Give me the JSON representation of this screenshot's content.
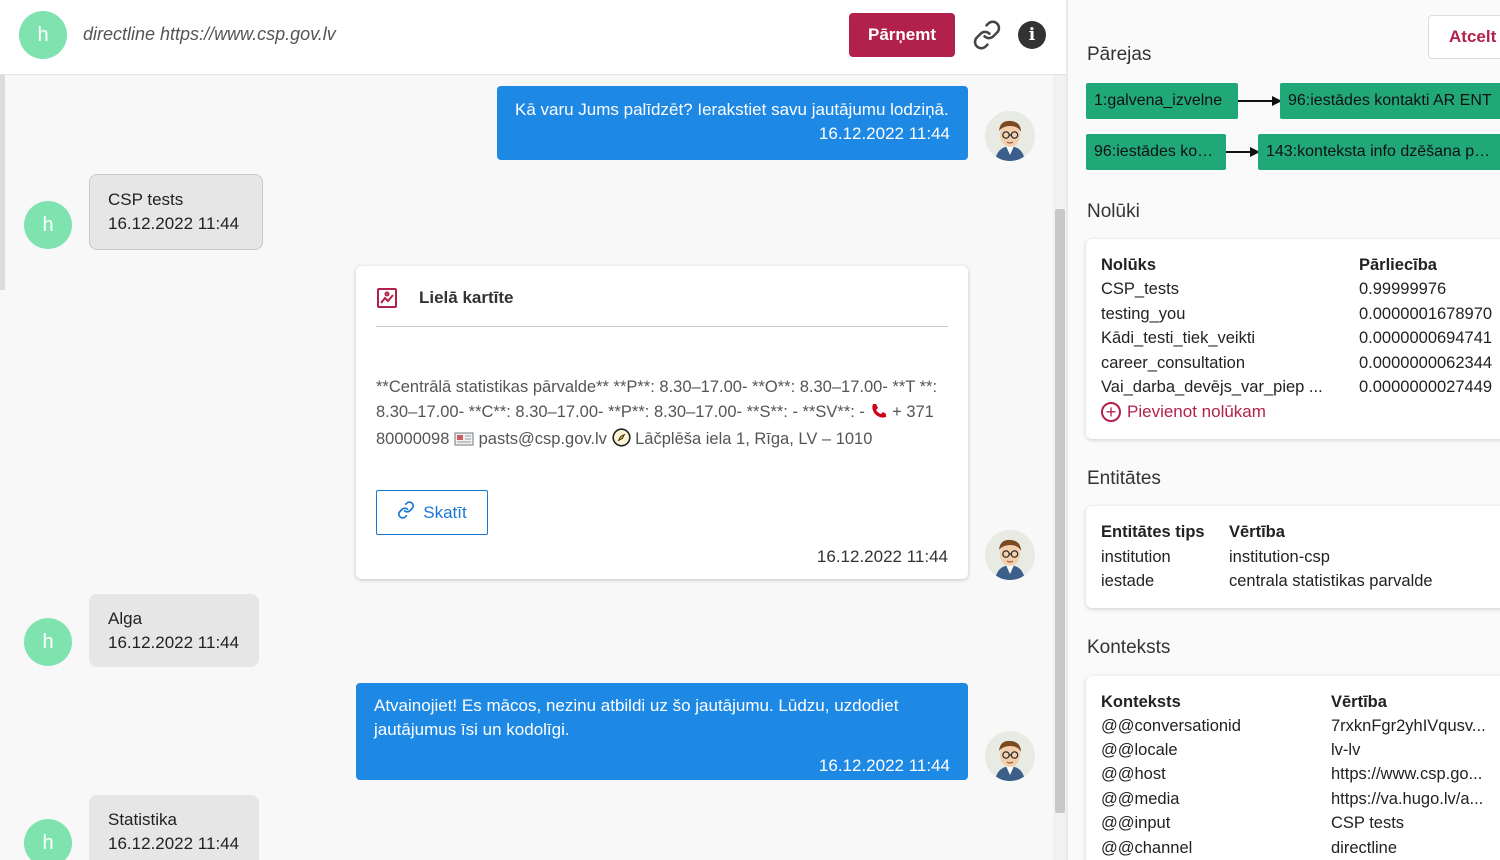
{
  "header": {
    "avatar_letter": "h",
    "title": "directline https://www.csp.gov.lv",
    "take_label": "Pārņemt"
  },
  "messages": [
    {
      "side": "bot",
      "text": "Kā varu Jums palīdzēt? Ierakstiet savu jautājumu lodziņā.",
      "time": "16.12.2022 11:44"
    },
    {
      "side": "user",
      "text": "CSP tests",
      "time": "16.12.2022 11:44"
    },
    {
      "side": "bot",
      "type": "card",
      "card_title": "Lielā kartīte",
      "card_text": "**Centrālā statistikas pārvalde** **P**: 8.30–17.00- **O**: 8.30–17.00- **T **: 8.30–17.00- **C**: 8.30–17.00- **P**: 8.30–17.00- **S**: - **SV**: - ",
      "phone": "+ 371 80000098",
      "email": "pasts@csp.gov.lv",
      "address": "Lāčplēša iela 1, Rīga, LV – 1010",
      "button_label": "Skatīt",
      "time": "16.12.2022 11:44"
    },
    {
      "side": "user",
      "text": "Alga",
      "time": "16.12.2022 11:44"
    },
    {
      "side": "bot",
      "text": "Atvainojiet! Es mācos, nezinu atbildi uz šo jautājumu. Lūdzu, uzdodiet jautājumus īsi un kodolīgi.",
      "time": "16.12.2022 11:44"
    },
    {
      "side": "user",
      "text": "Statistika",
      "time": "16.12.2022 11:44"
    }
  ],
  "right": {
    "cancel_label": "Atcelt",
    "transitions_title": "Pārejas",
    "transitions": [
      {
        "from": "1:galvena_izvelne",
        "to": "96:iestādes kontakti AR ENT"
      },
      {
        "from": "96:iestādes ko…",
        "to": "143:konteksta info dzēšana p…"
      }
    ],
    "intents_title": "Nolūki",
    "intents_header": {
      "name": "Nolūks",
      "confidence": "Pārliecība"
    },
    "intents": [
      {
        "name": "CSP_tests",
        "confidence": "0.99999976"
      },
      {
        "name": "testing_you",
        "confidence": "0.0000001678970"
      },
      {
        "name": "Kādi_testi_tiek_veikti",
        "confidence": "0.0000000694741"
      },
      {
        "name": "career_consultation",
        "confidence": "0.0000000062344"
      },
      {
        "name": "Vai_darba_devējs_var_piep ...",
        "confidence": "0.0000000027449"
      }
    ],
    "add_intent_label": "Pievienot nolūkam",
    "entities_title": "Entitātes",
    "entities_header": {
      "type": "Entitātes tips",
      "value": "Vērtība"
    },
    "entities": [
      {
        "type": "institution",
        "value": "institution-csp"
      },
      {
        "type": "iestade",
        "value": "centrala statistikas parvalde"
      }
    ],
    "context_title": "Konteksts",
    "context_header": {
      "key": "Konteksts",
      "value": "Vērtība"
    },
    "context": [
      {
        "key": "@@conversationid",
        "value": "7rxknFgr2yhIVqusv..."
      },
      {
        "key": "@@locale",
        "value": "lv-lv"
      },
      {
        "key": "@@host",
        "value": "https://www.csp.go..."
      },
      {
        "key": "@@media",
        "value": "https://va.hugo.lv/a..."
      },
      {
        "key": "@@input",
        "value": "CSP tests"
      },
      {
        "key": "@@channel",
        "value": "directline"
      }
    ]
  },
  "colors": {
    "accent": "#b2204c",
    "bot_bubble": "#1e88e5",
    "node": "#20a878",
    "avatar": "#7fe3b0"
  }
}
